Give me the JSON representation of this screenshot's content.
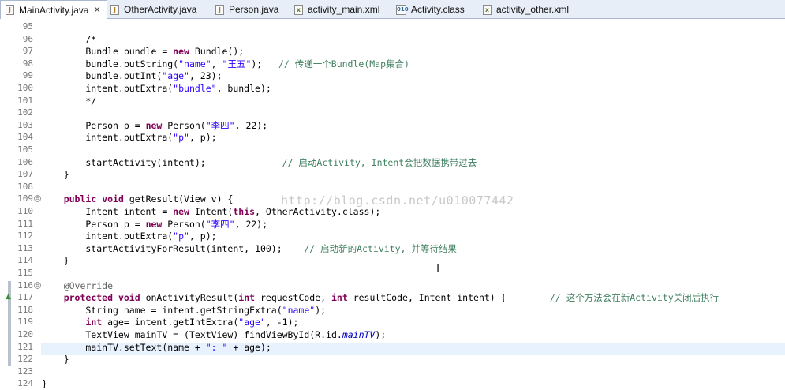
{
  "tabs": [
    {
      "label": "MainActivity.java",
      "icon": "java-file-icon",
      "active": true,
      "close": "✕"
    },
    {
      "label": "OtherActivity.java",
      "icon": "java-file-icon"
    },
    {
      "label": "Person.java",
      "icon": "java-file-icon"
    },
    {
      "label": "activity_main.xml",
      "icon": "xml-file-icon"
    },
    {
      "label": "Activity.class",
      "icon": "class-file-icon"
    },
    {
      "label": "activity_other.xml",
      "icon": "xml-file-icon"
    }
  ],
  "editor": {
    "watermark": "http://blog.csdn.net/u010077442",
    "current_line": "121",
    "lines": [
      {
        "n": "95",
        "t": ""
      },
      {
        "n": "96",
        "t": "        /*"
      },
      {
        "n": "97",
        "t": "        Bundle bundle = new Bundle();"
      },
      {
        "n": "98",
        "t": "        bundle.putString(\"name\", \"王五\");   // 传递一个Bundle(Map集合)"
      },
      {
        "n": "99",
        "t": "        bundle.putInt(\"age\", 23);"
      },
      {
        "n": "100",
        "t": "        intent.putExtra(\"bundle\", bundle);"
      },
      {
        "n": "101",
        "t": "        */"
      },
      {
        "n": "102",
        "t": ""
      },
      {
        "n": "103",
        "t": "        Person p = new Person(\"李四\", 22);"
      },
      {
        "n": "104",
        "t": "        intent.putExtra(\"p\", p);"
      },
      {
        "n": "105",
        "t": ""
      },
      {
        "n": "106",
        "t": "        startActivity(intent);              // 启动Activity, Intent会把数据携带过去"
      },
      {
        "n": "107",
        "t": "    }"
      },
      {
        "n": "108",
        "t": ""
      },
      {
        "n": "109",
        "t": "    public void getResult(View v) {"
      },
      {
        "n": "110",
        "t": "        Intent intent = new Intent(this, OtherActivity.class);"
      },
      {
        "n": "111",
        "t": "        Person p = new Person(\"李四\", 22);"
      },
      {
        "n": "112",
        "t": "        intent.putExtra(\"p\", p);"
      },
      {
        "n": "113",
        "t": "        startActivityForResult(intent, 100);    // 启动新的Activity, 并等待结果"
      },
      {
        "n": "114",
        "t": "    }"
      },
      {
        "n": "115",
        "t": ""
      },
      {
        "n": "116",
        "t": "    @Override"
      },
      {
        "n": "117",
        "t": "    protected void onActivityResult(int requestCode, int resultCode, Intent intent) {        // 这个方法会在新Activity关闭后执行"
      },
      {
        "n": "118",
        "t": "        String name = intent.getStringExtra(\"name\");"
      },
      {
        "n": "119",
        "t": "        int age= intent.getIntExtra(\"age\", -1);"
      },
      {
        "n": "120",
        "t": "        TextView mainTV = (TextView) findViewById(R.id.mainTV);"
      },
      {
        "n": "121",
        "t": "        mainTV.setText(name + \": \" + age);"
      },
      {
        "n": "122",
        "t": "    }"
      },
      {
        "n": "123",
        "t": ""
      },
      {
        "n": "124",
        "t": "}"
      }
    ]
  }
}
